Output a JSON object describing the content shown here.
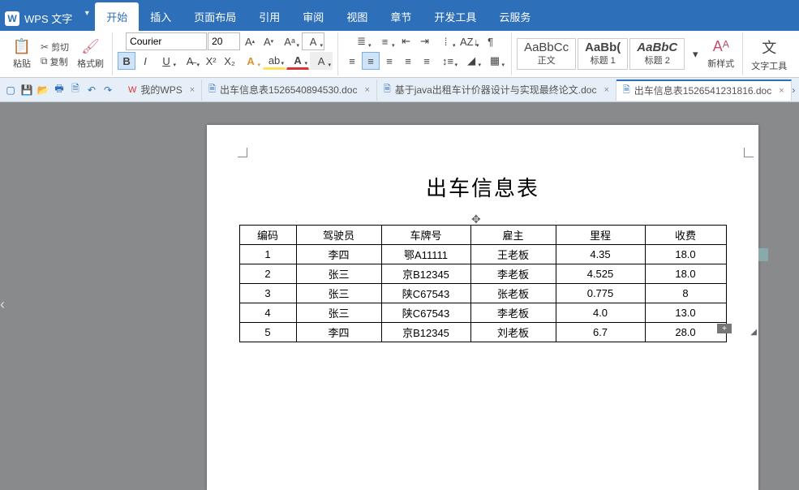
{
  "app": {
    "name": "WPS 文字"
  },
  "menu": {
    "items": [
      "开始",
      "插入",
      "页面布局",
      "引用",
      "审阅",
      "视图",
      "章节",
      "开发工具",
      "云服务"
    ],
    "active": 0
  },
  "ribbon": {
    "paste": "粘贴",
    "cut": "剪切",
    "copy": "复制",
    "format_painter": "格式刷",
    "font_name": "Courier",
    "font_size": "20",
    "styles": {
      "normal": {
        "preview": "AaBbCc",
        "label": "正文"
      },
      "h1": {
        "preview": "AaBb(",
        "label": "标题 1"
      },
      "h2": {
        "preview": "AaBbC",
        "label": "标题 2"
      }
    },
    "new_style": "新样式",
    "text_tools": "文字工具"
  },
  "tabs": [
    {
      "label": "我的WPS",
      "icon": "wps"
    },
    {
      "label": "出车信息表1526540894530.doc",
      "icon": "doc"
    },
    {
      "label": "基于java出租车计价器设计与实现最终论文.doc",
      "icon": "doc"
    },
    {
      "label": "出车信息表1526541231816.doc",
      "icon": "doc",
      "active": true
    }
  ],
  "document": {
    "title": "出车信息表",
    "headers": [
      "编码",
      "驾驶员",
      "车牌号",
      "雇主",
      "里程",
      "收费"
    ],
    "rows": [
      [
        "1",
        "李四",
        "鄂A11111",
        "王老板",
        "4.35",
        "18.0"
      ],
      [
        "2",
        "张三",
        "京B12345",
        "李老板",
        "4.525",
        "18.0"
      ],
      [
        "3",
        "张三",
        "陕C67543",
        "张老板",
        "0.775",
        "8"
      ],
      [
        "4",
        "张三",
        "陕C67543",
        "李老板",
        "4.0",
        "13.0"
      ],
      [
        "5",
        "李四",
        "京B12345",
        "刘老板",
        "6.7",
        "28.0"
      ]
    ]
  }
}
